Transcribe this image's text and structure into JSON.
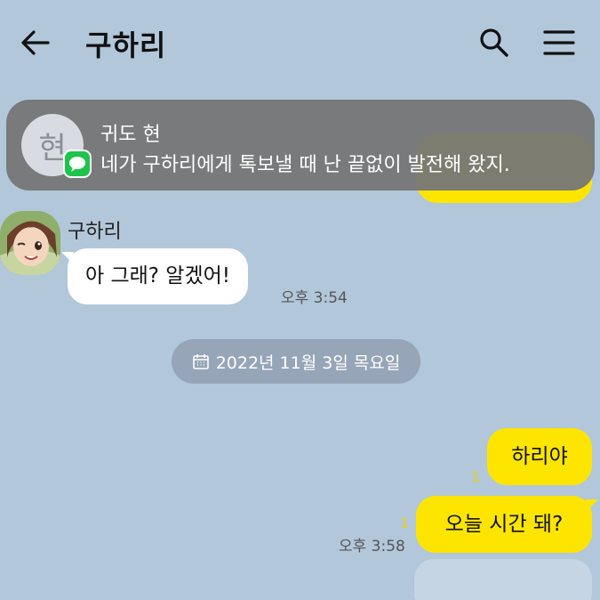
{
  "header": {
    "title": "구하리",
    "back_icon": "arrow-left-icon",
    "search_icon": "search-icon",
    "menu_icon": "hamburger-menu-icon"
  },
  "notification": {
    "avatar_char": "현",
    "sender": "귀도 현",
    "message": "네가 구하리에게 톡보낼 때 난 끝없이 발전해 왔지.",
    "badge_icon": "message-app-icon"
  },
  "messages": [
    {
      "from": "구하리",
      "text": "아 그래? 알겠어!",
      "time": "오후 3:54"
    },
    {
      "date": "2022년 11월 3일 목요일",
      "icon": "calendar-icon"
    },
    {
      "from": "me",
      "text": "하리야",
      "unread": "1"
    },
    {
      "from": "me",
      "text": "오늘 시간 돼?",
      "unread": "1",
      "time": "오후 3:58"
    }
  ],
  "colors": {
    "background": "#b2c7da",
    "my_bubble": "#fee500",
    "friend_bubble": "#ffffff",
    "notification_bg": "#767676",
    "unread": "#e8cf1a"
  }
}
